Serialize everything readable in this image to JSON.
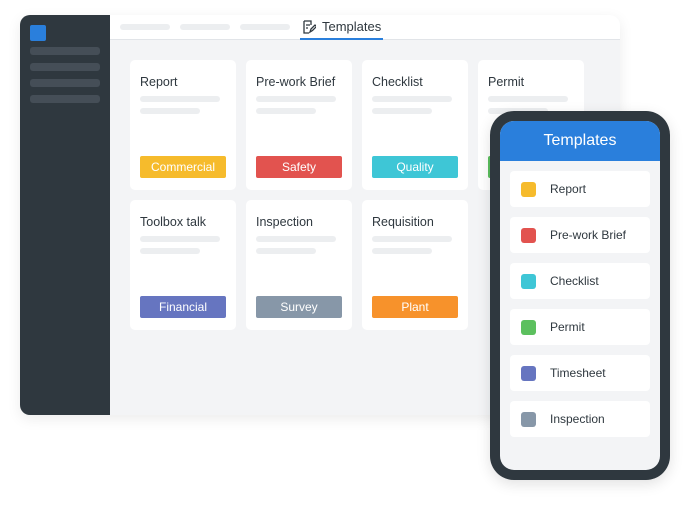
{
  "desktop": {
    "tab_label": "Templates",
    "tab_icon": "edit-document-icon",
    "cards": [
      {
        "title": "Report",
        "badge": "Commercial",
        "color": "#f6bb2c"
      },
      {
        "title": "Pre-work Brief",
        "badge": "Safety",
        "color": "#e2534f"
      },
      {
        "title": "Checklist",
        "badge": "Quality",
        "color": "#3ec6d6"
      },
      {
        "title": "Permit",
        "badge": "",
        "color": "#5cc05e"
      },
      {
        "title": "Toolbox talk",
        "badge": "Financial",
        "color": "#6675c0"
      },
      {
        "title": "Inspection",
        "badge": "Survey",
        "color": "#8797a8"
      },
      {
        "title": "Requisition",
        "badge": "Plant",
        "color": "#f7922b"
      }
    ]
  },
  "mobile": {
    "title": "Templates",
    "items": [
      {
        "label": "Report",
        "color": "#f6bb2c"
      },
      {
        "label": "Pre-work Brief",
        "color": "#e2534f"
      },
      {
        "label": "Checklist",
        "color": "#3ec6d6"
      },
      {
        "label": "Permit",
        "color": "#5cc05e"
      },
      {
        "label": "Timesheet",
        "color": "#6675c0"
      },
      {
        "label": "Inspection",
        "color": "#8797a8"
      }
    ]
  },
  "accent": "#2a7fdc"
}
